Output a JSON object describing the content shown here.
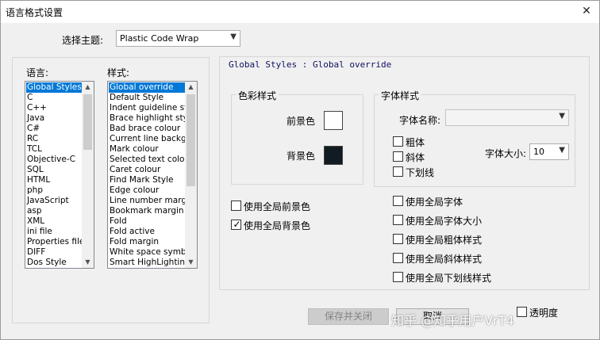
{
  "window": {
    "title": "语言格式设置",
    "close": "✕"
  },
  "theme": {
    "label": "选择主题:",
    "value": "Plastic Code Wrap"
  },
  "languages": {
    "label": "语言:",
    "items": [
      "Global Styles",
      "C",
      "C++",
      "Java",
      "C#",
      "RC",
      "TCL",
      "Objective-C",
      "SQL",
      "HTML",
      "php",
      "JavaScript",
      "asp",
      "XML",
      "ini file",
      "Properties file",
      "DIFF",
      "Dos Style"
    ],
    "selected": 0
  },
  "styles": {
    "label": "样式:",
    "items": [
      "Global override",
      "Default Style",
      "Indent guideline sty",
      "Brace highlight style",
      "Bad brace colour",
      "Current line backgr",
      "Mark colour",
      "Selected text colou",
      "Caret colour",
      "Find Mark Style",
      "Edge colour",
      "Line number margin",
      "Bookmark margin",
      "Fold",
      "Fold active",
      "Fold margin",
      "White space symbo",
      "Smart HighLighting"
    ],
    "selected": 0
  },
  "header_text": "Global Styles : Global override",
  "color_group": {
    "title": "色彩样式",
    "fg_label": "前景色",
    "bg_label": "背景色",
    "fg_color": "#ffffff",
    "bg_color": "#121b22"
  },
  "font_group": {
    "title": "字体样式",
    "name_label": "字体名称:",
    "name_value": "",
    "bold": "粗体",
    "italic": "斜体",
    "underline": "下划线",
    "size_label": "字体大小:",
    "size_value": "10"
  },
  "global_checks": {
    "fg": "使用全局前景色",
    "bg": "使用全局背景色",
    "font": "使用全局字体",
    "size": "使用全局字体大小",
    "bold": "使用全局粗体样式",
    "italic": "使用全局斜体样式",
    "underline": "使用全局下划线样式",
    "bg_checked": true
  },
  "buttons": {
    "save_close": "保存并关闭",
    "cancel": "取消"
  },
  "transparency": {
    "label": "透明度"
  },
  "watermark": "知乎 @知乎用户VrT4"
}
